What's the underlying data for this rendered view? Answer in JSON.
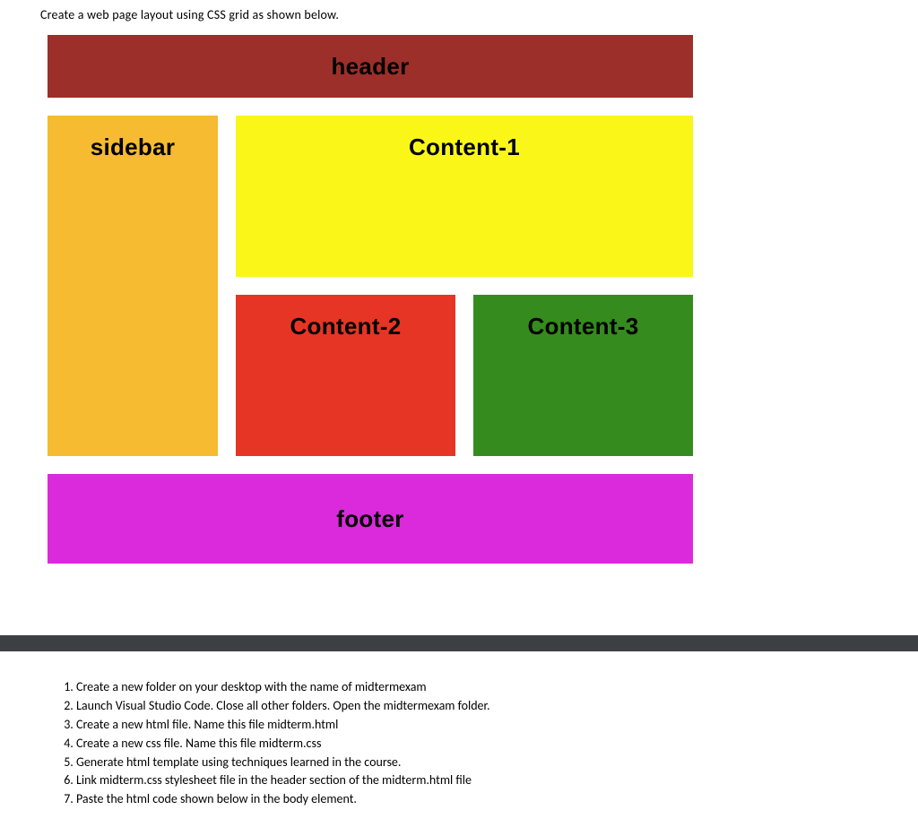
{
  "intro": "Create a web page layout using CSS grid as shown below.",
  "grid": {
    "header": "header",
    "sidebar": "sidebar",
    "content1": "Content-1",
    "content2": "Content-2",
    "content3": "Content-3",
    "footer": "footer"
  },
  "colors": {
    "header": "#9c2f2a",
    "sidebar": "#f6bb30",
    "content1": "#faf718",
    "content2": "#e63524",
    "content3": "#358b1d",
    "footer": "#db2adb",
    "divider": "#3d4043"
  },
  "steps": [
    "Create a new folder on your desktop with the name of midtermexam",
    "Launch Visual Studio Code.  Close all other folders.  Open the midtermexam folder.",
    "Create a new html file. Name this file midterm.html",
    "Create a new css file. Name this file midterm.css",
    " Generate html template using techniques learned in the course.",
    "Link midterm.css stylesheet file in the header section of the midterm.html file",
    " Paste the html code shown below in the body element."
  ]
}
